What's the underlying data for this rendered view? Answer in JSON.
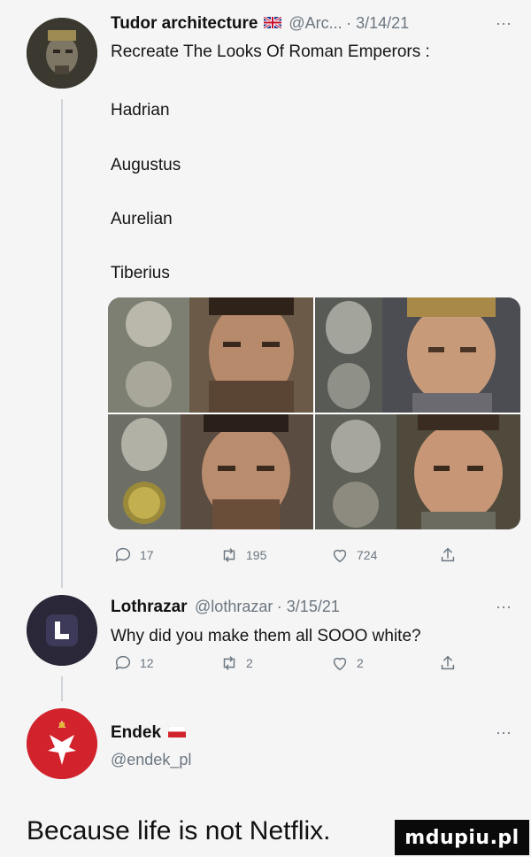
{
  "tweet1": {
    "name": "Tudor architecture",
    "handle": "@Arc...",
    "date": "· 3/14/21",
    "more": "···",
    "text_line": "Recreate The Looks Of Roman Emperors :",
    "list": [
      "Hadrian",
      "Augustus",
      "Aurelian",
      "Tiberius"
    ],
    "stats": {
      "replies": "17",
      "retweets": "195",
      "likes": "724"
    }
  },
  "tweet2": {
    "name": "Lothrazar",
    "handle": "@lothrazar",
    "date": "· 3/15/21",
    "more": "···",
    "text": "Why did you make them all SOOO white?",
    "stats": {
      "replies": "12",
      "retweets": "2",
      "likes": "2"
    }
  },
  "tweet3": {
    "name": "Endek",
    "handle": "@endek_pl",
    "more": "···",
    "text": "Because life is not Netflix."
  },
  "watermark": "mdupiu.pl",
  "colors": {
    "muted": "#6b7680",
    "line": "#cfd4d8"
  }
}
